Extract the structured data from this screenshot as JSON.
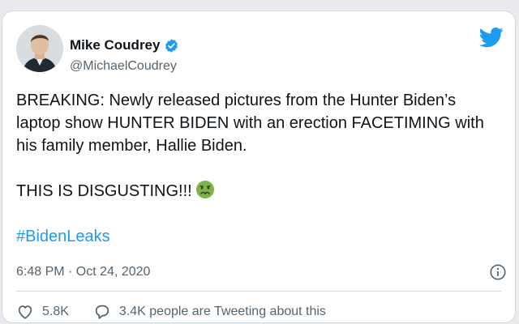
{
  "tweet": {
    "author_name": "Mike Coudrey",
    "author_handle": "@MichaelCoudrey",
    "verified": true,
    "text_line1": "BREAKING: Newly released pictures from the Hunter Biden’s laptop show HUNTER BIDEN with an erection FACETIMING with his family member, Hallie Biden.",
    "text_line2": "THIS IS DISGUSTING!!!",
    "hashtag": "#BidenLeaks",
    "timestamp": "6:48 PM · Oct 24, 2020",
    "likes": "5.8K",
    "tweeting_about": "3.4K people are Tweeting about this"
  },
  "icons": {
    "brand": "twitter-bird-icon",
    "verified": "verified-badge-icon",
    "emoji": "nauseated-face-emoji",
    "info": "info-icon",
    "like": "heart-icon",
    "reply": "speech-bubble-icon"
  },
  "colors": {
    "accent": "#1d9bf0",
    "text": "#0f1419",
    "muted": "#536471",
    "emoji_face": "#7fb24a"
  }
}
